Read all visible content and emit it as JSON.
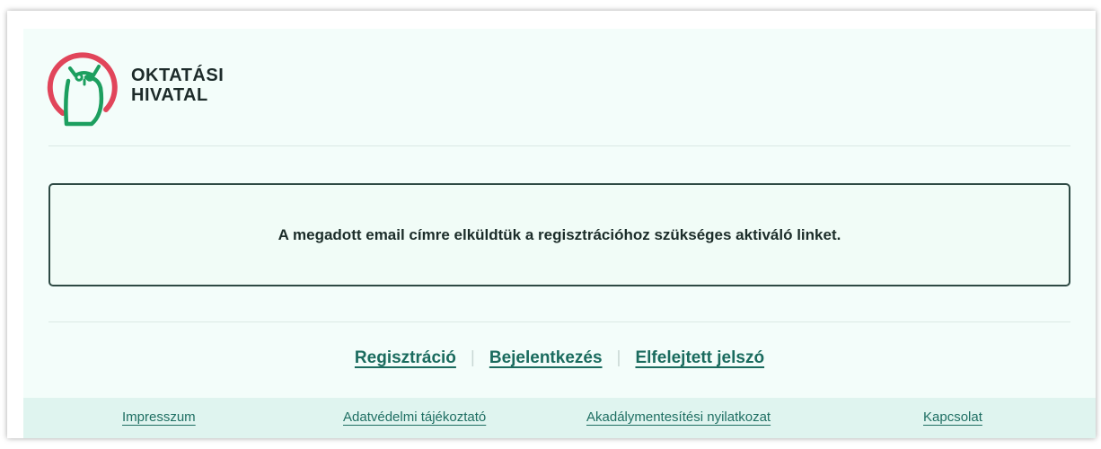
{
  "brand": {
    "logo_icon": "owl-logo-icon",
    "name_line1": "OKTATÁSI",
    "name_line2": "HIVATAL",
    "colors": {
      "ring": "#e1455a",
      "owl": "#1c9f5f",
      "text": "#1d2b2a"
    }
  },
  "alert": {
    "message": "A megadott email címre elküldtük a regisztrációhoz szükséges aktiváló linket."
  },
  "auth_links": {
    "register": "Regisztráció",
    "login": "Bejelentkezés",
    "forgot_password": "Elfelejtett jelszó",
    "separator": "|"
  },
  "footer": {
    "imprint": "Impresszum",
    "privacy": "Adatvédelmi tájékoztató",
    "accessibility": "Akadálymentesítési nyilatkozat",
    "contact": "Kapcsolat"
  },
  "theme": {
    "page_bg": "#f3fdfa",
    "footer_bg": "#dff4ef",
    "link_color": "#1a6b5e",
    "alert_border": "#2e4a44"
  }
}
